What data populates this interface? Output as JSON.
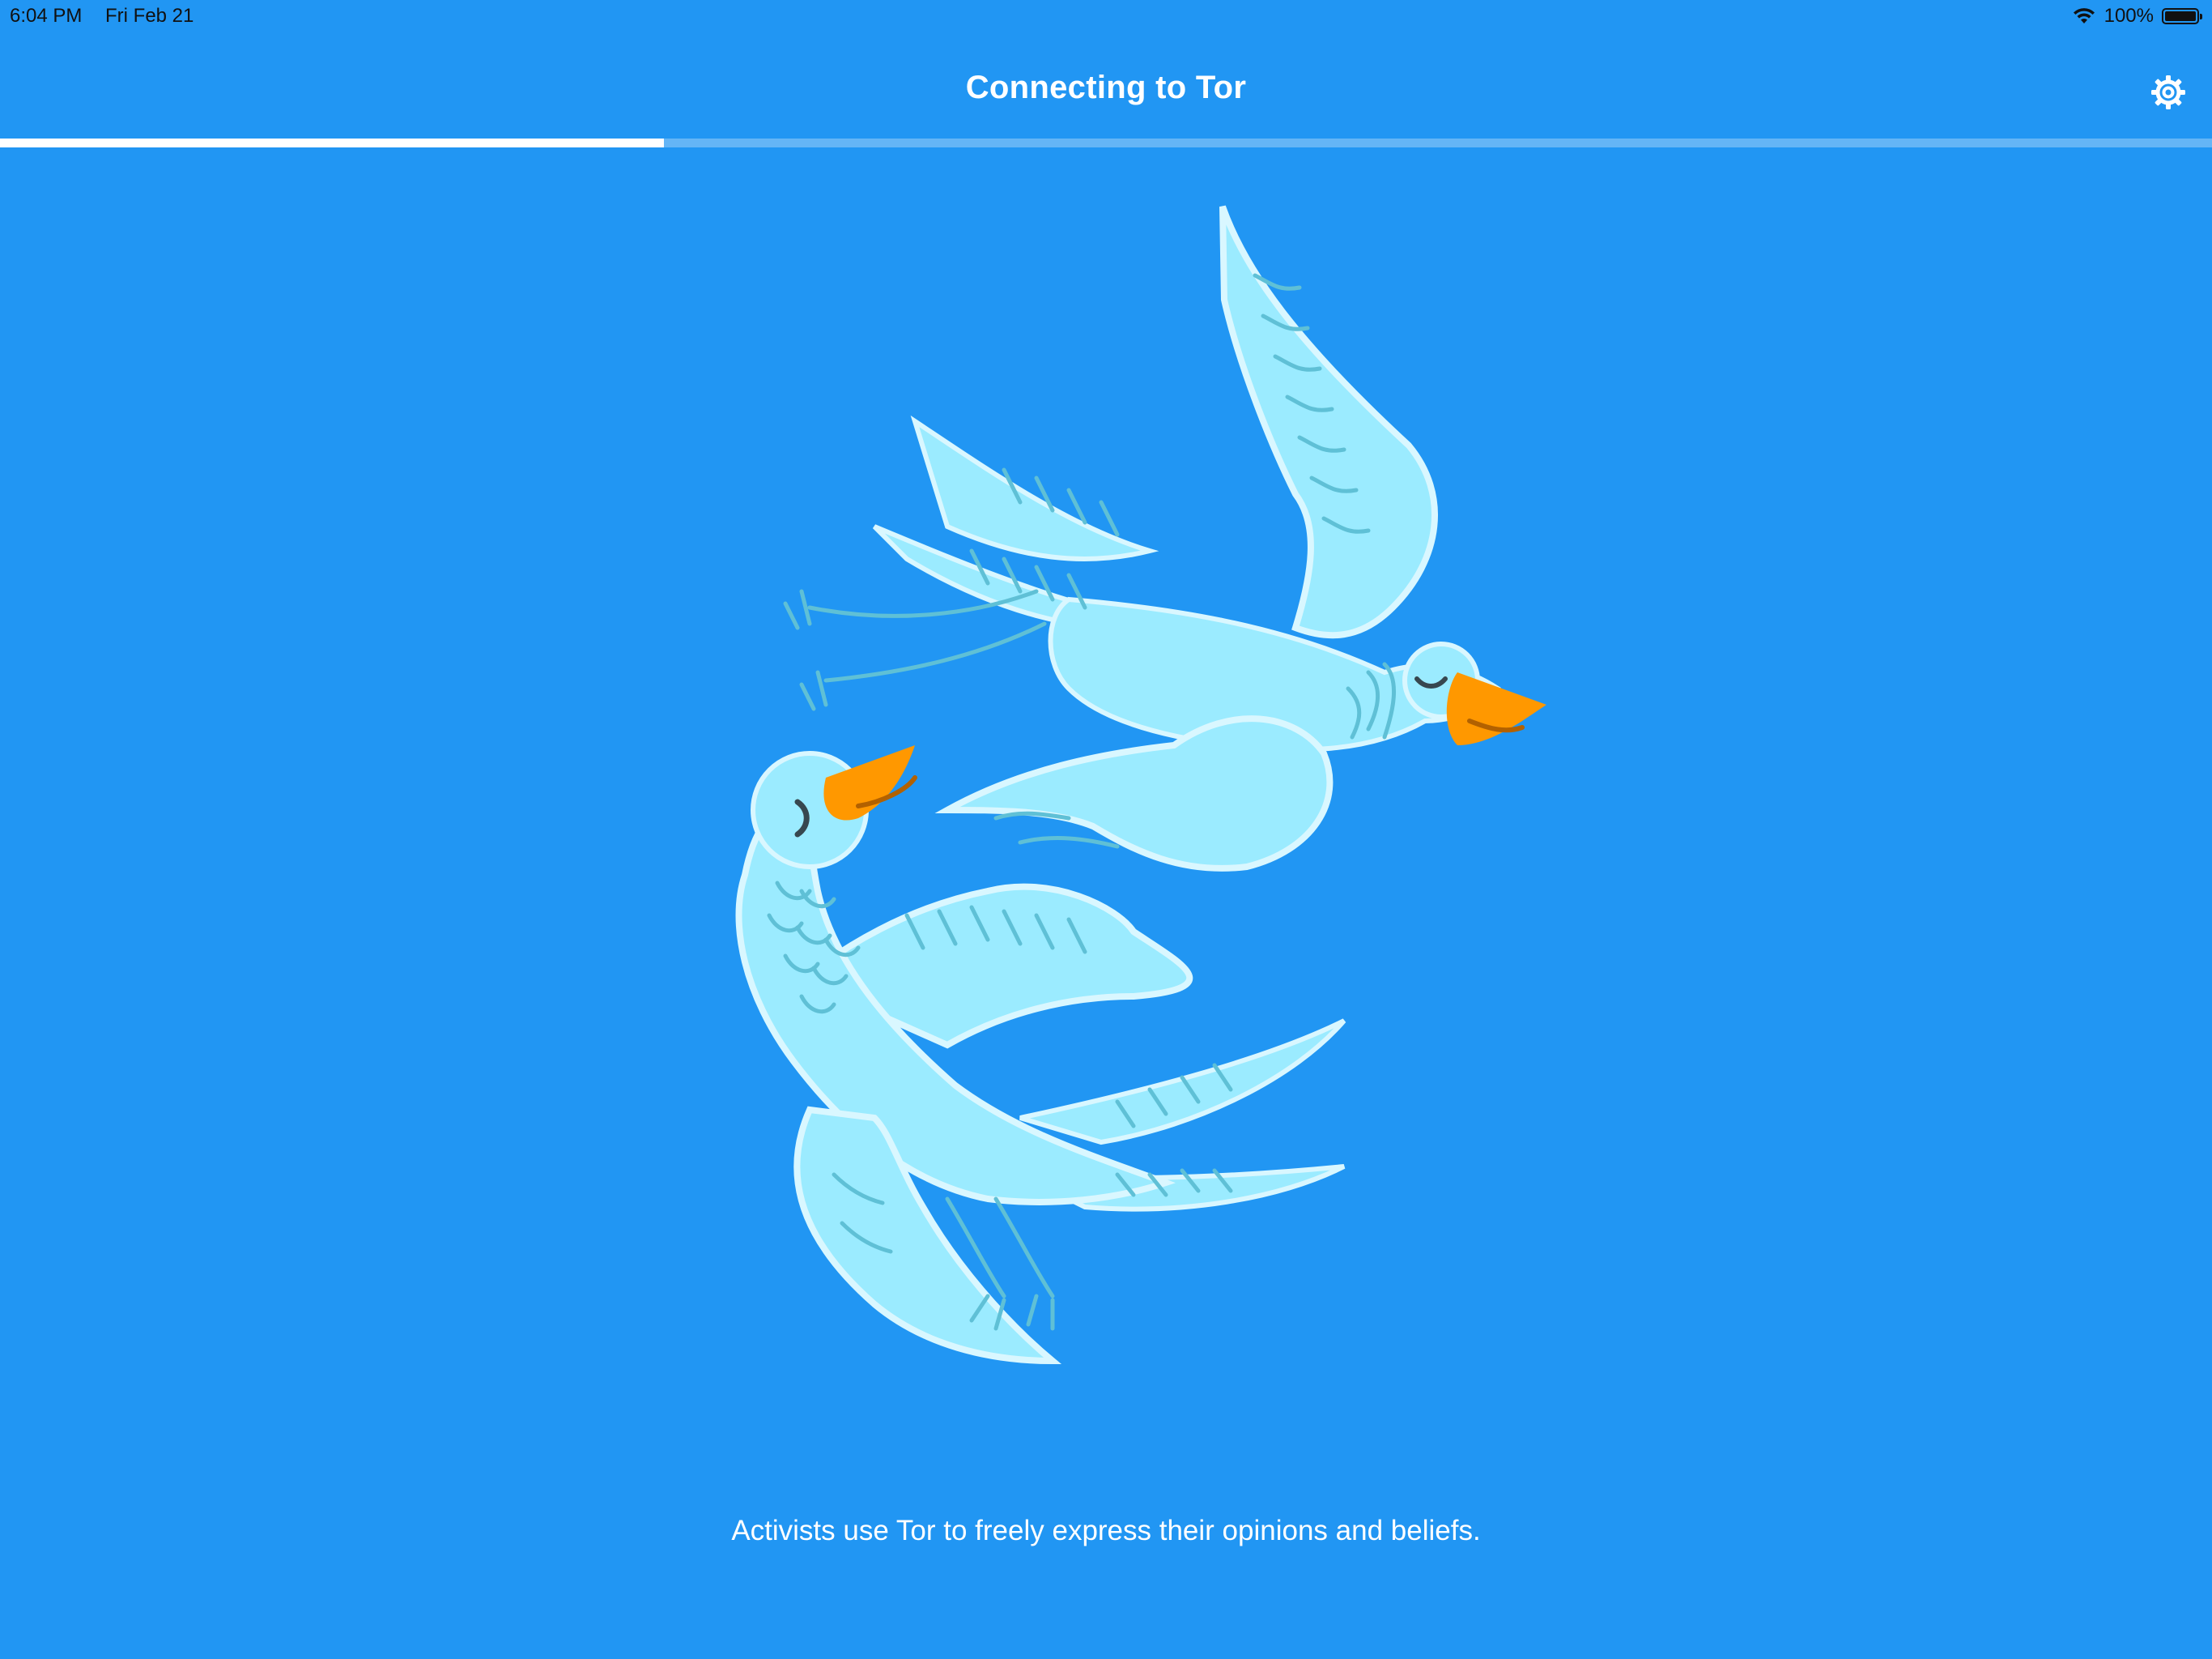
{
  "status_bar": {
    "time": "6:04 PM",
    "date": "Fri Feb 21",
    "battery_percent": "100%",
    "wifi_icon": "wifi-icon",
    "battery_icon": "battery-icon"
  },
  "nav": {
    "title": "Connecting to Tor",
    "settings_icon": "gear-icon"
  },
  "progress": {
    "fraction": 0.3
  },
  "illustration": {
    "subject": "two-flying-birds"
  },
  "caption": "Activists use Tor to freely express their opinions and beliefs.",
  "colors": {
    "background": "#2196F3",
    "progress_fill": "#FFFFFF",
    "progress_track": "#64B5F6",
    "bird_body": "#9BEBFF",
    "bird_outline": "#D9F7FF",
    "bird_detail": "#5FC0D6",
    "beak": "#FF9800"
  }
}
